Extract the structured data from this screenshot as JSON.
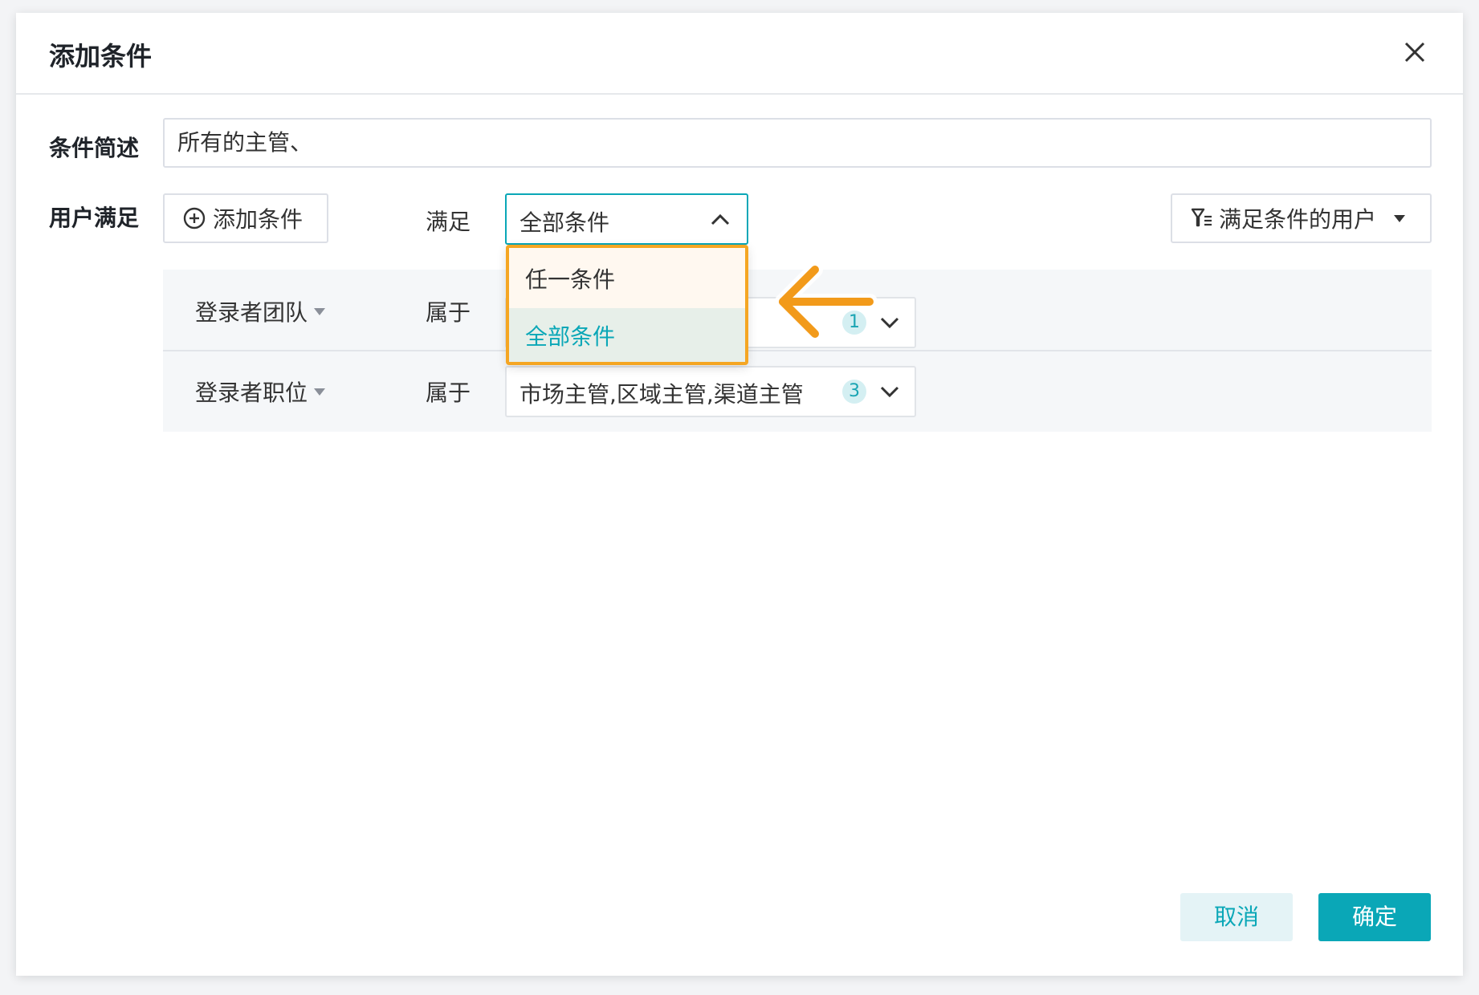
{
  "dialog": {
    "title": "添加条件"
  },
  "description": {
    "label": "条件简述",
    "value": "所有的主管、"
  },
  "user_match": {
    "label": "用户满足",
    "add_condition_label": "添加条件",
    "match_label": "满足",
    "match_selected": "全部条件",
    "filter_button_label": "满足条件的用户"
  },
  "dropdown": {
    "options": [
      {
        "label": "任一条件",
        "selected": false
      },
      {
        "label": "全部条件",
        "selected": true
      }
    ]
  },
  "conditions": [
    {
      "field": "登录者团队",
      "operator": "属于",
      "value": "",
      "count": "1"
    },
    {
      "field": "登录者职位",
      "operator": "属于",
      "value": "市场主管,区域主管,渠道主管",
      "count": "3"
    }
  ],
  "footer": {
    "cancel_label": "取消",
    "confirm_label": "确定"
  },
  "colors": {
    "accent": "#0aa7b7",
    "annotation": "#f5a623"
  },
  "icons": {
    "close": "close-icon",
    "add": "plus-circle-icon",
    "chevron_up": "chevron-up-icon",
    "chevron_down": "chevron-down-icon",
    "filter": "filter-icon",
    "caret_down": "caret-down-icon"
  }
}
